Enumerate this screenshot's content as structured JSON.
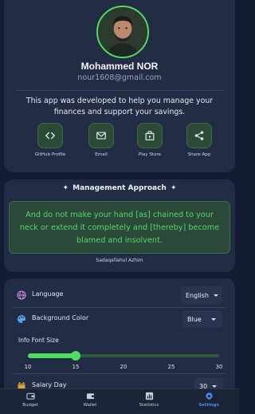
{
  "profile": {
    "name": "Mohammed NOR",
    "email": "nour1608@gmail.com",
    "about": "This app was developed to help you manage your finances and support your savings.",
    "links": [
      {
        "label": "GitHub Profile",
        "icon": "code-icon"
      },
      {
        "label": "Email",
        "icon": "email-icon"
      },
      {
        "label": "Play Store",
        "icon": "play-store-icon"
      },
      {
        "label": "Share App",
        "icon": "share-icon"
      }
    ]
  },
  "quote": {
    "title": "Management Approach",
    "text": "And do not make your hand [as] chained to your neck or extend it completely and [thereby] become blamed and insolvent.",
    "author": "Sadaqallahul Azhim"
  },
  "settings": {
    "language": {
      "label": "Language",
      "value": "English",
      "icon": "globe-icon"
    },
    "background": {
      "label": "Background Color",
      "value": "Blue",
      "icon": "palette-icon"
    },
    "font_size": {
      "label": "Info Font Size",
      "value": 15,
      "min": 10,
      "max": 30,
      "ticks": [
        "10",
        "15",
        "20",
        "25",
        "30"
      ]
    },
    "salary_day": {
      "label": "Salary Day",
      "value": "30",
      "icon": "calendar-icon"
    }
  },
  "nav": [
    {
      "label": "Budget",
      "icon": "wallet-outline-icon",
      "active": false
    },
    {
      "label": "Wallet",
      "icon": "wallet-icon",
      "active": false
    },
    {
      "label": "Statistics",
      "icon": "bar-chart-icon",
      "active": false
    },
    {
      "label": "Settings",
      "icon": "gear-icon",
      "active": true
    }
  ],
  "colors": {
    "accent": "#4ede5f",
    "active_nav": "#4b8cf5",
    "background": "#141c33",
    "card": "#232c45"
  }
}
